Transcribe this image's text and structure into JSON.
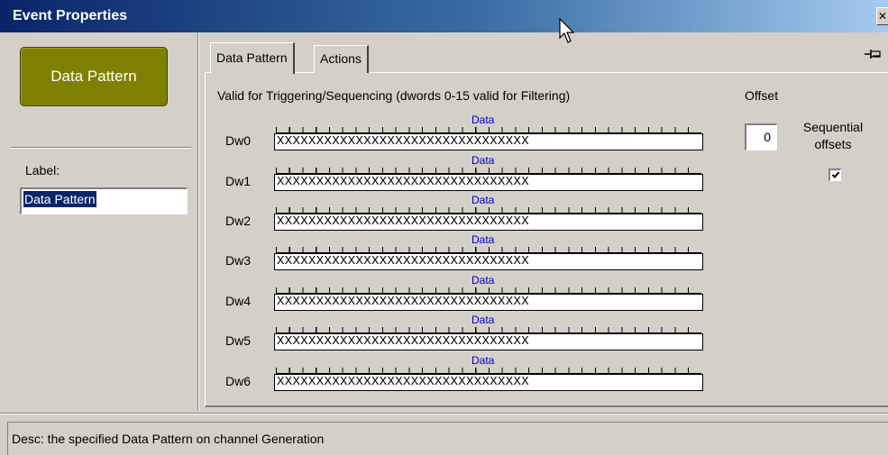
{
  "window": {
    "title": "Event Properties",
    "close_label": "✕"
  },
  "sidebar": {
    "big_button_label": "Data Pattern",
    "label_caption": "Label:",
    "label_value": "Data Pattern"
  },
  "tabs": [
    {
      "label": "Data Pattern",
      "active": true
    },
    {
      "label": "Actions",
      "active": false
    }
  ],
  "main": {
    "valid_text": "Valid for Triggering/Sequencing (dwords 0-15 valid for Filtering)",
    "offset_label": "Offset",
    "offset_value": "0",
    "sequential_label_1": "Sequential",
    "sequential_label_2": "offsets",
    "sequential_checked": true,
    "dwords": [
      {
        "label": "Dw0",
        "data_label": "Data",
        "value": "XXXXXXXXXXXXXXXXXXXXXXXXXXXXXXXX"
      },
      {
        "label": "Dw1",
        "data_label": "Data",
        "value": "XXXXXXXXXXXXXXXXXXXXXXXXXXXXXXXX"
      },
      {
        "label": "Dw2",
        "data_label": "Data",
        "value": "XXXXXXXXXXXXXXXXXXXXXXXXXXXXXXXX"
      },
      {
        "label": "Dw3",
        "data_label": "Data",
        "value": "XXXXXXXXXXXXXXXXXXXXXXXXXXXXXXXX"
      },
      {
        "label": "Dw4",
        "data_label": "Data",
        "value": "XXXXXXXXXXXXXXXXXXXXXXXXXXXXXXXX"
      },
      {
        "label": "Dw5",
        "data_label": "Data",
        "value": "XXXXXXXXXXXXXXXXXXXXXXXXXXXXXXXX"
      },
      {
        "label": "Dw6",
        "data_label": "Data",
        "value": "XXXXXXXXXXXXXXXXXXXXXXXXXXXXXXXX"
      }
    ]
  },
  "status": {
    "desc": "Desc: the specified Data Pattern on channel Generation"
  },
  "icons": {
    "pin": "pin-icon",
    "cursor": "mouse-cursor-icon",
    "check": "check-icon"
  }
}
